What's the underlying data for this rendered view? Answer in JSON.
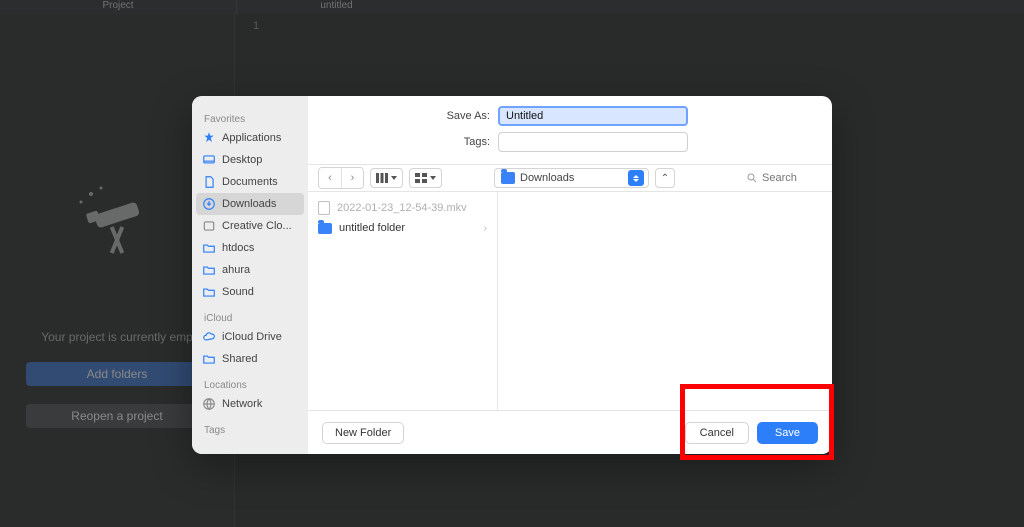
{
  "background": {
    "tab_project": "Project",
    "tab_untitled": "untitled",
    "line_number": "1",
    "empty_msg": "Your project is currently emp",
    "add_folders": "Add folders",
    "reopen": "Reopen a project"
  },
  "dialog": {
    "save_as_label": "Save As:",
    "save_as_value": "Untitled",
    "tags_label": "Tags:",
    "location": "Downloads",
    "search_placeholder": "Search",
    "new_folder": "New Folder",
    "cancel": "Cancel",
    "save": "Save",
    "sidebar": {
      "favorites_header": "Favorites",
      "icloud_header": "iCloud",
      "locations_header": "Locations",
      "tags_header": "Tags",
      "items": [
        "Applications",
        "Desktop",
        "Documents",
        "Downloads",
        "Creative Clo...",
        "htdocs",
        "ahura",
        "Sound"
      ],
      "icloud_items": [
        "iCloud Drive",
        "Shared"
      ],
      "location_items": [
        "Network"
      ]
    },
    "files": [
      {
        "name": "2022-01-23_12-54-39.mkv",
        "type": "file",
        "dimmed": true
      },
      {
        "name": "untitled folder",
        "type": "folder",
        "dimmed": false
      }
    ]
  }
}
